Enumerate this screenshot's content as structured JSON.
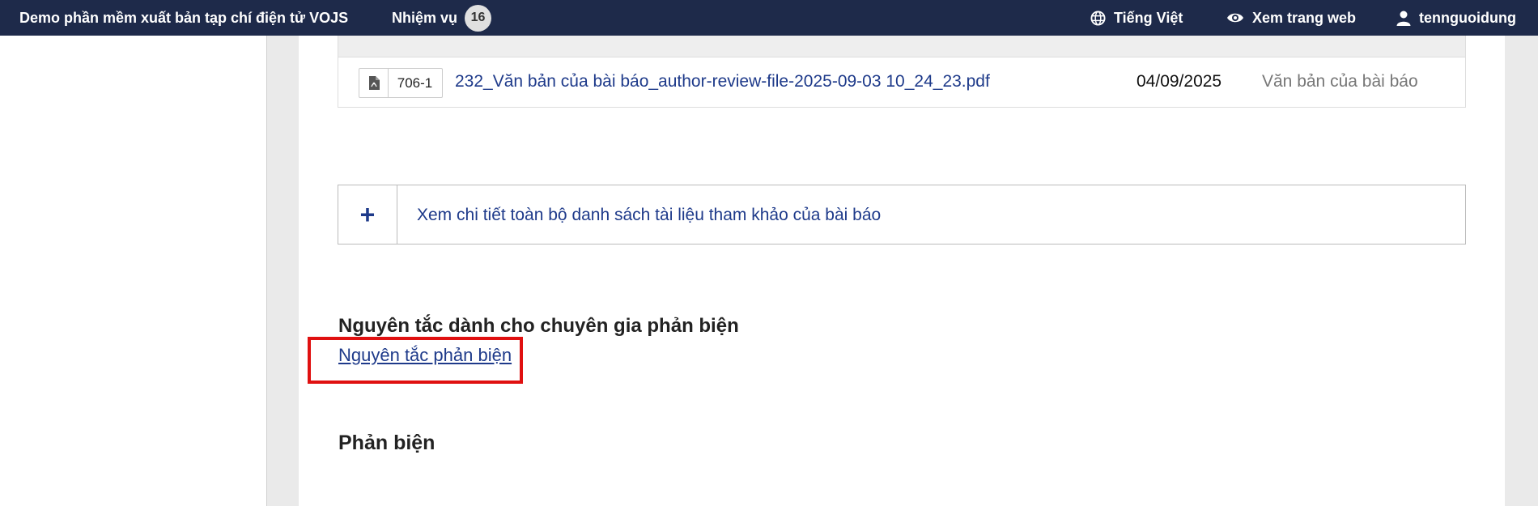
{
  "topbar": {
    "site_title": "Demo phần mềm xuất bản tạp chí điện tử VOJS",
    "tasks_label": "Nhiệm vụ",
    "tasks_count": "16",
    "language": "Tiếng Việt",
    "view_site": "Xem trang web",
    "username": "tennguoidung"
  },
  "files": {
    "rows": [
      {
        "type_icon": "pdf-file-icon",
        "id": "706-1",
        "name": "232_Văn bản của bài báo_author-review-file-2025-09-03 10_24_23.pdf",
        "date": "04/09/2025",
        "kind": "Văn bản của bài báo"
      }
    ]
  },
  "references": {
    "toggle": "+",
    "label": "Xem chi tiết toàn bộ danh sách tài liệu tham khảo của bài báo"
  },
  "guidelines": {
    "heading": "Nguyên tắc dành cho chuyên gia phản biện",
    "link": "Nguyên tắc phản biện"
  },
  "review": {
    "heading": "Phản biện"
  },
  "highlight_color": "#e01010",
  "accent_color": "#1e3a8a"
}
